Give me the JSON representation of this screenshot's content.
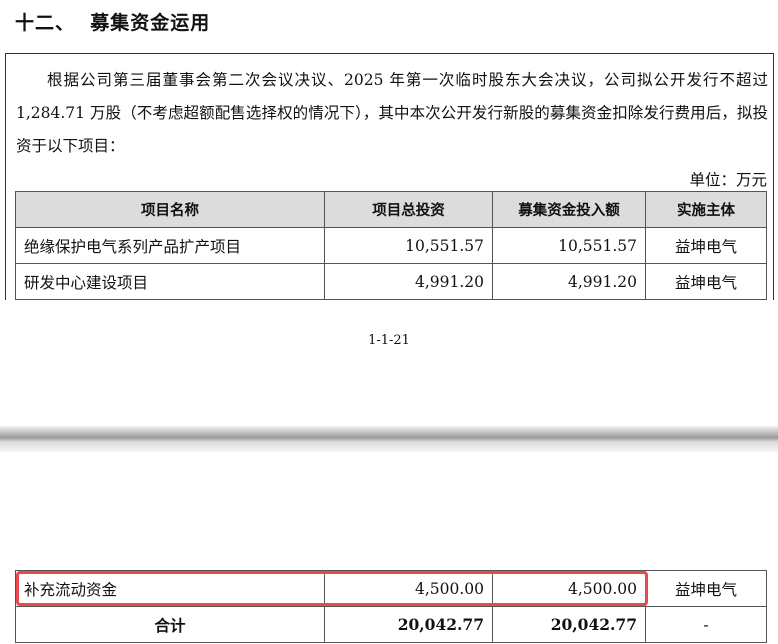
{
  "heading": "十二、  募集资金运用",
  "paragraph": "根据公司第三届董事会第二次会议决议、2025 年第一次临时股东大会决议，公司拟公开发行不超过 1,284.71 万股（不考虑超额配售选择权的情况下），其中本次公开发行新股的募集资金扣除发行费用后，拟投资于以下项目：",
  "unit": "单位：万元",
  "table": {
    "headers": [
      "项目名称",
      "项目总投资",
      "募集资金投入额",
      "实施主体"
    ],
    "rows": [
      {
        "name": "绝缘保护电气系列产品扩产项目",
        "total": "10,551.57",
        "raised": "10,551.57",
        "entity": "益坤电气"
      },
      {
        "name": "研发中心建设项目",
        "total": "4,991.20",
        "raised": "4,991.20",
        "entity": "益坤电气"
      }
    ],
    "continued_rows": [
      {
        "name": "补充流动资金",
        "total": "4,500.00",
        "raised": "4,500.00",
        "entity": "益坤电气"
      }
    ],
    "total_row": {
      "name": "合计",
      "total": "20,042.77",
      "raised": "20,042.77",
      "entity": "-"
    }
  },
  "page_number": "1-1-21",
  "highlight_color": "#e8494f"
}
